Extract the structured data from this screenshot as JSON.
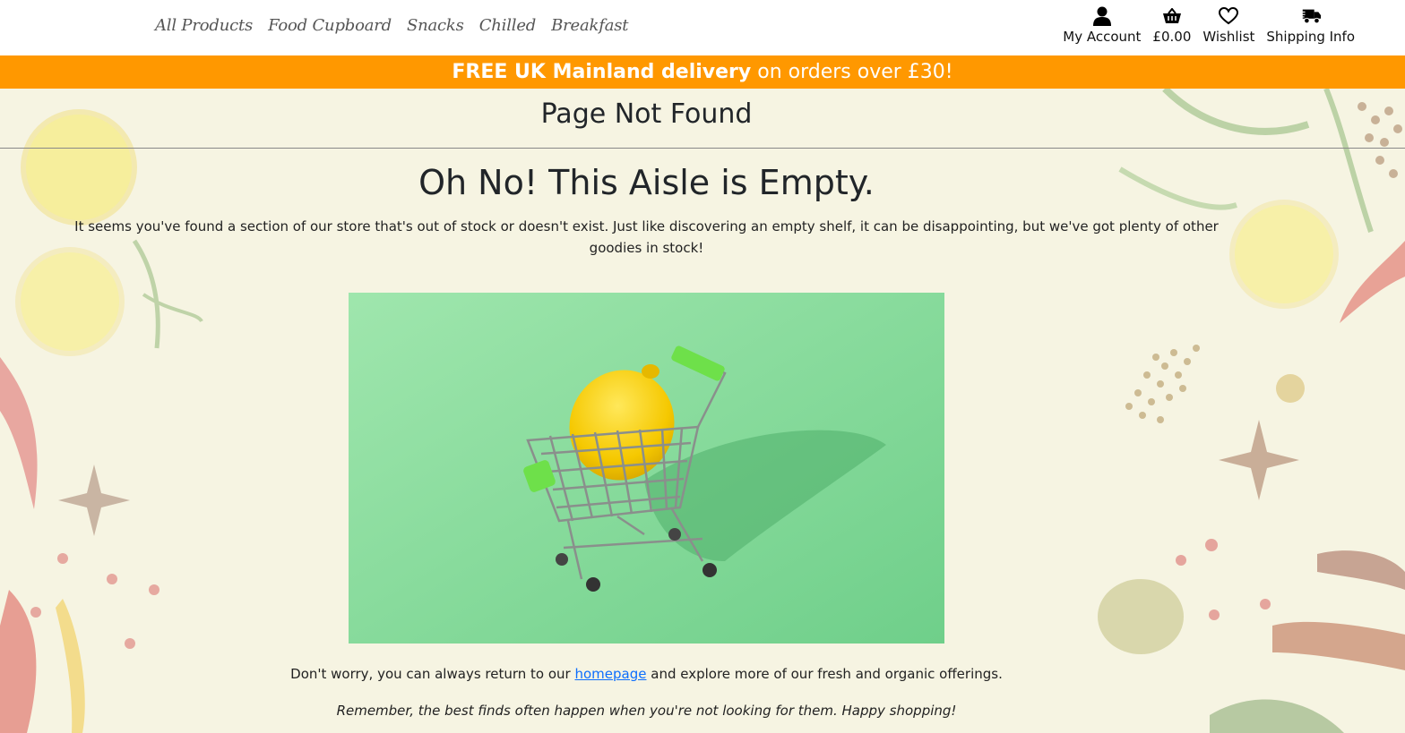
{
  "nav": {
    "categories": [
      "All Products",
      "Food Cupboard",
      "Snacks",
      "Chilled",
      "Breakfast"
    ]
  },
  "util_nav": {
    "account_label": "My Account",
    "basket_total": "£0.00",
    "wishlist_label": "Wishlist",
    "shipping_label": "Shipping Info"
  },
  "banner": {
    "bold_text": "FREE UK Mainland delivery",
    "rest_text": " on orders over £30!",
    "color": "#ff9800"
  },
  "page": {
    "heading": "Page Not Found",
    "title": "Oh No! This Aisle is Empty.",
    "intro": "It seems you've found a section of our store that's out of stock or doesn't exist. Just like discovering an empty shelf, it can be disappointing, but we've got plenty of other goodies in stock!",
    "return_before": "Don't worry, you can always return to our ",
    "return_link": "homepage",
    "return_after": " and explore more of our fresh and organic offerings.",
    "remember": "Remember, the best finds often happen when you're not looking for them. Happy shopping!"
  },
  "icons": {
    "account": "user-icon",
    "basket": "basket-icon",
    "wishlist": "heart-icon",
    "shipping": "truck-icon"
  }
}
